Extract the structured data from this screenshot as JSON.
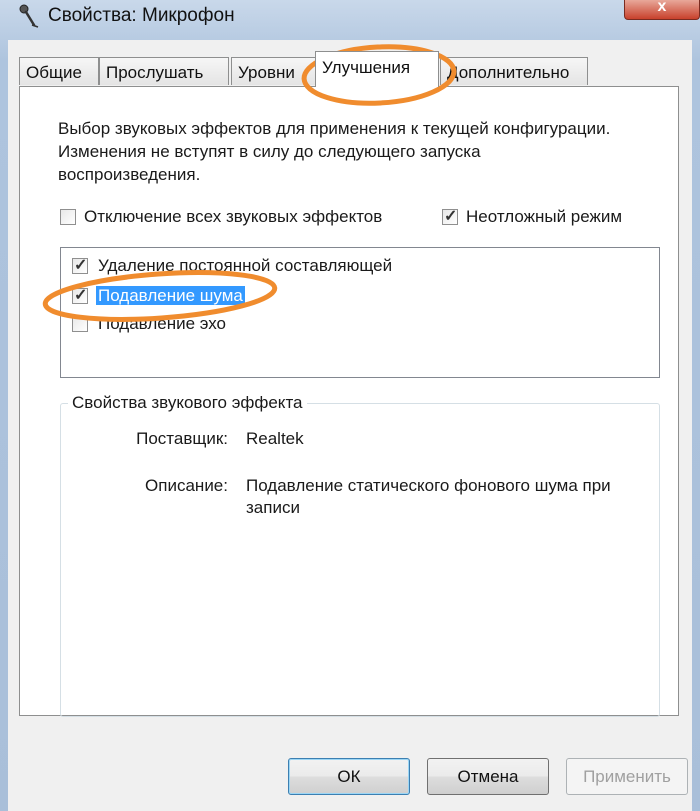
{
  "window": {
    "title": "Свойства: Микрофон",
    "close_glyph": "x"
  },
  "tabs": [
    {
      "label": "Общие",
      "active": false
    },
    {
      "label": "Прослушать",
      "active": false
    },
    {
      "label": "Уровни",
      "active": false
    },
    {
      "label": "Улучшения",
      "active": true
    },
    {
      "label": "Дополнительно",
      "active": false
    }
  ],
  "panel": {
    "description": "Выбор звуковых эффектов для применения к текущей конфигурации. Изменения не вступят в силу до следующего запуска воспроизведения.",
    "disable_all": {
      "label": "Отключение всех звуковых эффектов",
      "checked": false
    },
    "immediate_mode": {
      "label": "Неотложный режим",
      "checked": true
    },
    "effects": [
      {
        "label": "Удаление постоянной составляющей",
        "checked": true,
        "selected": false
      },
      {
        "label": "Подавление шума",
        "checked": true,
        "selected": true
      },
      {
        "label": "Подавление эхо",
        "checked": false,
        "selected": false
      }
    ],
    "properties": {
      "title": "Свойства звукового эффекта",
      "provider_label": "Поставщик:",
      "provider_value": "Realtek",
      "description_label": "Описание:",
      "description_value": "Подавление статического фонового шума при записи"
    }
  },
  "buttons": {
    "ok": "ОК",
    "cancel": "Отмена",
    "apply": "Применить"
  },
  "colors": {
    "highlight": "#3399ff",
    "annotation": "#f08c2e"
  },
  "icons": {
    "title_icon": "microphone-icon",
    "check": "✓"
  }
}
